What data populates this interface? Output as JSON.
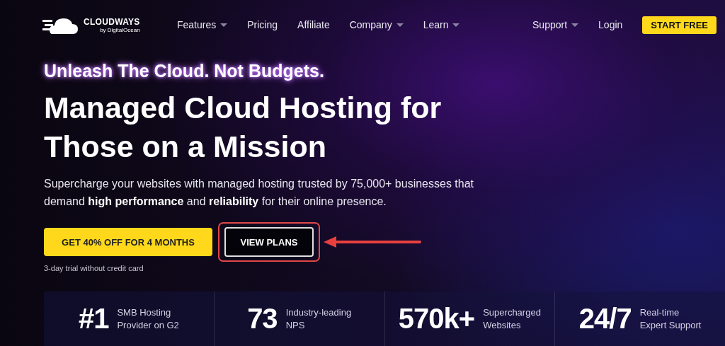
{
  "logo": {
    "name": "CLOUDWAYS",
    "byline": "by DigitalOcean"
  },
  "nav": [
    {
      "label": "Features",
      "has_dropdown": true
    },
    {
      "label": "Pricing",
      "has_dropdown": false
    },
    {
      "label": "Affiliate",
      "has_dropdown": false
    },
    {
      "label": "Company",
      "has_dropdown": true
    },
    {
      "label": "Learn",
      "has_dropdown": true
    }
  ],
  "nav_right": [
    {
      "label": "Support",
      "has_dropdown": true
    },
    {
      "label": "Login",
      "has_dropdown": false
    }
  ],
  "cta_nav": "START FREE",
  "hero": {
    "tagline": "Unleash The Cloud. Not Budgets.",
    "headline": [
      "Managed Cloud Hosting for",
      "Those on a Mission"
    ],
    "description": "Supercharge your websites with managed hosting trusted by 75,000+ businesses that demand **high performance** and **reliability** for their online presence.",
    "primary_button": "GET 40% OFF FOR 4 MONTHS",
    "secondary_button": "VIEW PLANS",
    "secondary_highlighted": true,
    "note": "3-day trial without credit card"
  },
  "stats": [
    {
      "value": "#1",
      "label": [
        "SMB Hosting",
        "Provider on G2"
      ]
    },
    {
      "value": "73",
      "label": [
        "Industry-leading",
        "NPS"
      ]
    },
    {
      "value": "570k+",
      "label": [
        "Supercharged",
        "Websites"
      ]
    },
    {
      "value": "24/7",
      "label": [
        "Real-time",
        "Expert Support"
      ]
    }
  ]
}
